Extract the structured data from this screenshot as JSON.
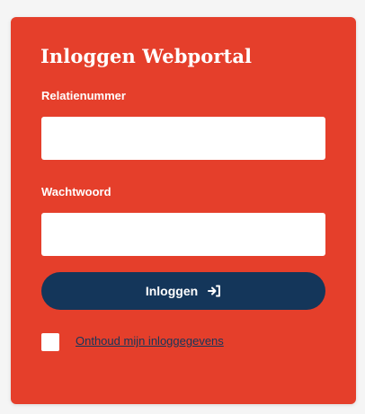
{
  "login": {
    "title": "Inloggen Webportal",
    "relation_label": "Relatienummer",
    "relation_value": "",
    "password_label": "Wachtwoord",
    "password_value": "",
    "submit_label": "Inloggen",
    "submit_icon": "sign-in-arrow-icon",
    "remember_label": "Onthoud mijn inloggegevens",
    "remember_checked": false
  },
  "colors": {
    "panel": "#e53f2b",
    "button": "#14365a",
    "text": "#ffffff",
    "link": "#14365a"
  }
}
